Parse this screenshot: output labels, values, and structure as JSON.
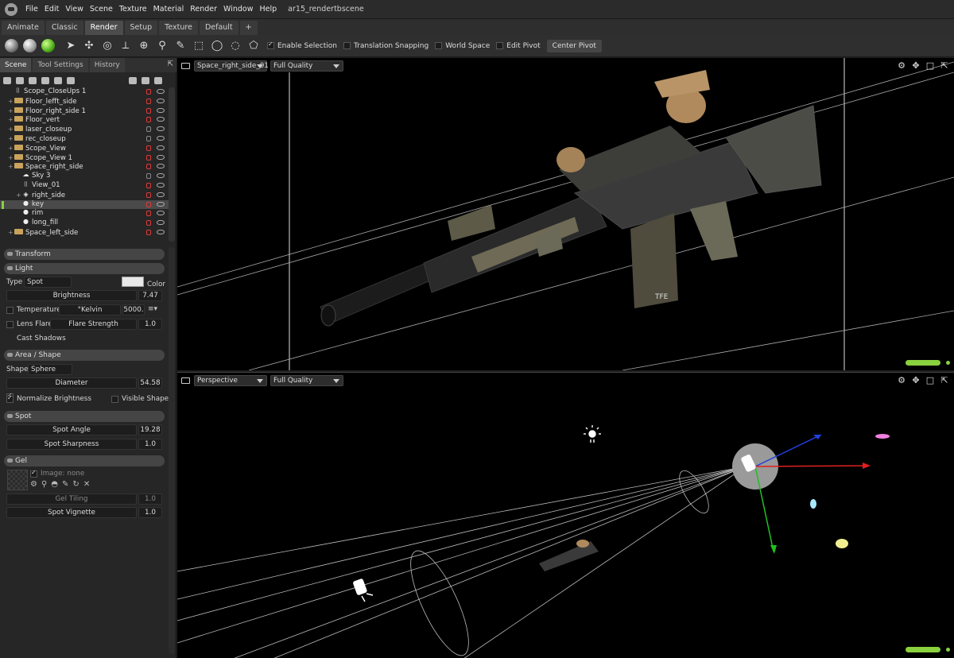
{
  "app": {
    "menu": [
      "File",
      "Edit",
      "View",
      "Scene",
      "Texture",
      "Material",
      "Render",
      "Window",
      "Help"
    ],
    "document_title": "ar15_rendertbscene"
  },
  "panel_tabs": [
    {
      "label": "Animate",
      "active": false
    },
    {
      "label": "Classic",
      "active": false
    },
    {
      "label": "Render",
      "active": true
    },
    {
      "label": "Setup",
      "active": false
    },
    {
      "label": "Texture",
      "active": false
    },
    {
      "label": "Default",
      "active": false
    },
    {
      "label": "+",
      "active": false
    }
  ],
  "toolbar": {
    "options": [
      {
        "label": "Enable Selection",
        "checked": true
      },
      {
        "label": "Translation Snapping",
        "checked": false
      },
      {
        "label": "World Space",
        "checked": false
      },
      {
        "label": "Edit Pivot",
        "checked": false
      }
    ],
    "center_pivot": "Center Pivot"
  },
  "left_panel": {
    "tabs": [
      {
        "label": "Scene",
        "active": true
      },
      {
        "label": "Tool Settings",
        "active": false
      },
      {
        "label": "History",
        "active": false
      }
    ],
    "tree": [
      {
        "label": "Scope_CloseUps 1",
        "indent": 0,
        "icon": "camera-icon",
        "lock": "red",
        "selected": false
      },
      {
        "label": "Floor_lefft_side",
        "indent": 0,
        "icon": "folder-icon",
        "lock": "red",
        "selected": false
      },
      {
        "label": "Floor_right_side 1",
        "indent": 0,
        "icon": "folder-icon",
        "lock": "red",
        "selected": false
      },
      {
        "label": "Floor_vert",
        "indent": 0,
        "icon": "folder-icon",
        "lock": "red",
        "selected": false
      },
      {
        "label": "laser_closeup",
        "indent": 0,
        "icon": "folder-icon",
        "lock": "grey",
        "selected": false
      },
      {
        "label": "rec_closeup",
        "indent": 0,
        "icon": "folder-icon",
        "lock": "grey",
        "selected": false
      },
      {
        "label": "Scope_View",
        "indent": 0,
        "icon": "folder-icon",
        "lock": "red",
        "selected": false
      },
      {
        "label": "Scope_View 1",
        "indent": 0,
        "icon": "folder-icon",
        "lock": "red",
        "selected": false
      },
      {
        "label": "Space_right_side",
        "indent": 0,
        "icon": "folder-icon",
        "lock": "red",
        "selected": false
      },
      {
        "label": "Sky 3",
        "indent": 1,
        "icon": "sky-icon",
        "lock": "grey",
        "selected": false
      },
      {
        "label": "View_01",
        "indent": 1,
        "icon": "camera-icon",
        "lock": "red",
        "selected": false
      },
      {
        "label": "right_side",
        "indent": 1,
        "icon": "object-icon",
        "lock": "red",
        "selected": false
      },
      {
        "label": "key",
        "indent": 1,
        "icon": "light-icon",
        "lock": "red",
        "selected": true
      },
      {
        "label": "rim",
        "indent": 1,
        "icon": "light-icon",
        "lock": "red",
        "selected": false
      },
      {
        "label": "long_fill",
        "indent": 1,
        "icon": "light-icon",
        "lock": "red",
        "selected": false
      },
      {
        "label": "Space_left_side",
        "indent": 0,
        "icon": "folder-icon",
        "lock": "red",
        "selected": false
      }
    ],
    "sections": {
      "transform": "Transform",
      "light": "Light",
      "area_shape": "Area / Shape",
      "spot": "Spot",
      "gel": "Gel"
    },
    "light": {
      "type_label": "Type",
      "type_value": "Spot",
      "color_label": "Color",
      "brightness_label": "Brightness",
      "brightness_value": "7.47",
      "temperature_label": "Temperature",
      "kelvin_label": "°Kelvin",
      "kelvin_value": "5000.",
      "lens_flare_label": "Lens Flare",
      "flare_strength_label": "Flare Strength",
      "flare_strength_value": "1.0",
      "cast_shadows_label": "Cast Shadows"
    },
    "area_shape": {
      "shape_label": "Shape",
      "shape_value": "Sphere",
      "diameter_label": "Diameter",
      "diameter_value": "54.58",
      "normalize_label": "Normalize Brightness",
      "visible_shape_label": "Visible Shape"
    },
    "spot": {
      "angle_label": "Spot Angle",
      "angle_value": "19.28",
      "sharpness_label": "Spot Sharpness",
      "sharpness_value": "1.0"
    },
    "gel": {
      "image_label": "Image: none",
      "tiling_label": "Gel Tiling",
      "tiling_value": "1.0",
      "vignette_label": "Spot Vignette",
      "vignette_value": "1.0"
    }
  },
  "viewport_top": {
    "camera": "Space_right_side_01",
    "quality": "Full Quality"
  },
  "viewport_bottom": {
    "camera": "Perspective",
    "quality": "Full Quality"
  },
  "colors": {
    "accent_green": "#8ad13e",
    "lock_red": "#e03a3a",
    "axis_x": "#e02020",
    "axis_y": "#20c020",
    "axis_z": "#2040e0",
    "folder": "#c9a35b"
  }
}
